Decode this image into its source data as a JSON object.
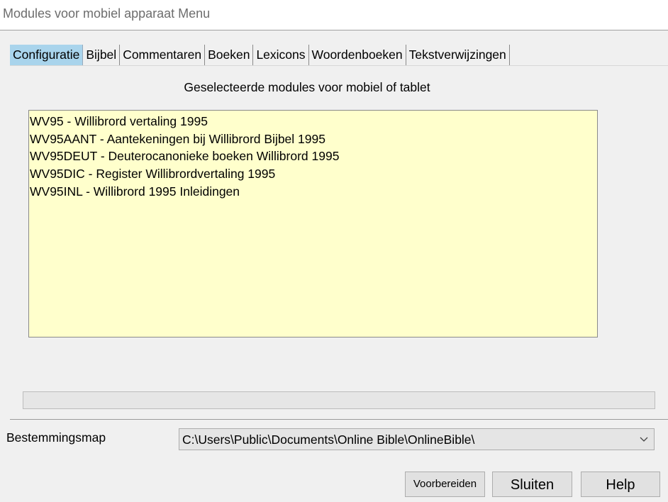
{
  "window": {
    "title": "Modules voor mobiel apparaat Menu"
  },
  "tabs": [
    {
      "label": "Configuratie",
      "active": true
    },
    {
      "label": "Bijbel",
      "active": false
    },
    {
      "label": "Commentaren",
      "active": false
    },
    {
      "label": "Boeken",
      "active": false
    },
    {
      "label": "Lexicons",
      "active": false
    },
    {
      "label": "Woordenboeken",
      "active": false
    },
    {
      "label": "Tekstverwijzingen",
      "active": false
    }
  ],
  "configuratie": {
    "heading": "Geselecteerde modules voor mobiel of tablet",
    "modules": [
      "WV95 - Willibrord vertaling 1995",
      "WV95AANT - Aantekeningen bij Willibrord Bijbel 1995",
      "WV95DEUT - Deuterocanonieke boeken Willibrord 1995",
      "WV95DIC - Register Willibrordvertaling 1995",
      "WV95INL - Willibrord 1995 Inleidingen"
    ],
    "progress": 0
  },
  "destination": {
    "label": "Bestemmingsmap",
    "value": "C:\\Users\\Public\\Documents\\Online Bible\\OnlineBible\\",
    "icon": "chevron-down-icon"
  },
  "buttons": {
    "prepare": "Voorbereiden",
    "close": "Sluiten",
    "help": "Help"
  },
  "colors": {
    "active_tab": "#a9d4ec",
    "list_background": "#ffffcc",
    "window_background": "#f0f0f0"
  }
}
